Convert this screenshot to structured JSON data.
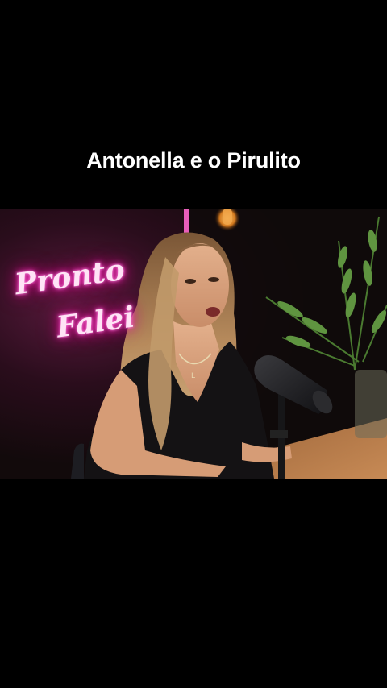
{
  "overlay": {
    "caption": "Antonella e o Pirulito"
  },
  "video": {
    "neon_sign": {
      "line1": "Pronto",
      "line2": "Falei",
      "color": "#ff3cc8"
    }
  },
  "colors": {
    "background": "#000000",
    "caption_text": "#ffffff",
    "neon_pink": "#ff3cc8"
  }
}
